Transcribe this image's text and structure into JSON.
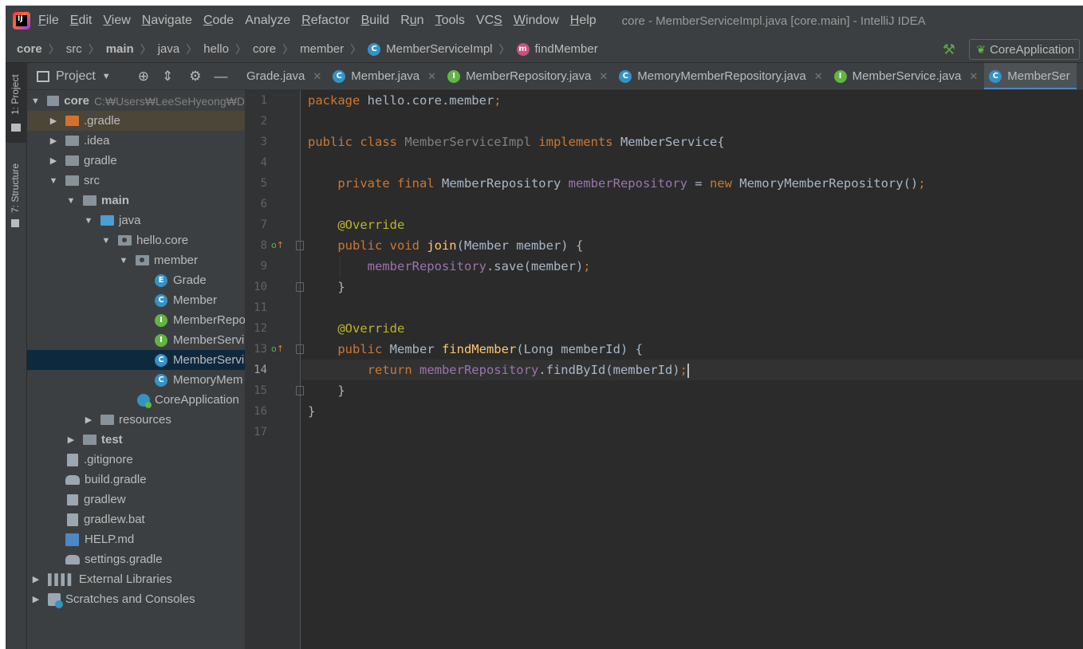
{
  "menubar": {
    "items": [
      {
        "underline": "F",
        "rest": "ile"
      },
      {
        "underline": "E",
        "rest": "dit"
      },
      {
        "underline": "V",
        "rest": "iew"
      },
      {
        "underline": "N",
        "rest": "avigate"
      },
      {
        "underline": "C",
        "rest": "ode"
      },
      {
        "underline": "",
        "rest": "Analyze"
      },
      {
        "underline": "R",
        "rest": "efactor"
      },
      {
        "underline": "B",
        "rest": "uild"
      },
      {
        "pre": "R",
        "underline": "u",
        "rest": "n"
      },
      {
        "underline": "T",
        "rest": "ools"
      },
      {
        "pre": "VC",
        "underline": "S",
        "rest": ""
      },
      {
        "underline": "W",
        "rest": "indow"
      },
      {
        "underline": "H",
        "rest": "elp"
      }
    ],
    "window_title": "core - MemberServiceImpl.java [core.main] - IntelliJ IDEA"
  },
  "navbar": {
    "crumbs": [
      "core",
      "src",
      "main",
      "java",
      "hello",
      "core",
      "member",
      "MemberServiceImpl",
      "findMember"
    ],
    "run_config": "CoreApplication"
  },
  "tool_strip": {
    "project_tab": "1: Project",
    "structure_tab": "7: Structure"
  },
  "project_panel": {
    "title": "Project",
    "tree": [
      {
        "label": "core",
        "hint": "C:₩Users₩LeeSeHyeong₩D"
      },
      {
        "label": ".gradle"
      },
      {
        "label": ".idea"
      },
      {
        "label": "gradle"
      },
      {
        "label": "src"
      },
      {
        "label": "main"
      },
      {
        "label": "java"
      },
      {
        "label": "hello.core"
      },
      {
        "label": "member"
      },
      {
        "label": "Grade"
      },
      {
        "label": "Member"
      },
      {
        "label": "MemberRepo"
      },
      {
        "label": "MemberServi"
      },
      {
        "label": "MemberServi"
      },
      {
        "label": "MemoryMem"
      },
      {
        "label": "CoreApplication"
      },
      {
        "label": "resources"
      },
      {
        "label": "test"
      },
      {
        "label": ".gitignore"
      },
      {
        "label": "build.gradle"
      },
      {
        "label": "gradlew"
      },
      {
        "label": "gradlew.bat"
      },
      {
        "label": "HELP.md"
      },
      {
        "label": "settings.gradle"
      },
      {
        "label": "External Libraries"
      },
      {
        "label": "Scratches and Consoles"
      }
    ]
  },
  "editor": {
    "tabs": [
      {
        "label": "Grade.java"
      },
      {
        "label": "Member.java",
        "icon": "C"
      },
      {
        "label": "MemberRepository.java",
        "icon": "I"
      },
      {
        "label": "MemoryMemberRepository.java",
        "icon": "C"
      },
      {
        "label": "MemberService.java",
        "icon": "I"
      },
      {
        "label": "MemberSer",
        "icon": "C"
      }
    ],
    "line_numbers": [
      "1",
      "2",
      "3",
      "4",
      "5",
      "6",
      "7",
      "8",
      "9",
      "10",
      "11",
      "12",
      "13",
      "14",
      "15",
      "16",
      "17"
    ],
    "current_line": "14",
    "code": {
      "l1_kw": "package ",
      "l1_rest": "hello.core.member",
      "l1_semi": ";",
      "l3_kw": "public class ",
      "l3_cls": "MemberServiceImpl ",
      "l3_kw2": "implements ",
      "l3_rest": "MemberService{",
      "l5_kw": "private final ",
      "l5_type": "MemberRepository ",
      "l5_field": "memberRepository",
      "l5_eq": " = ",
      "l5_new": "new ",
      "l5_rest": "MemoryMemberRepository()",
      "l5_semi": ";",
      "l7_ann": "@Override",
      "l8_kw": "public void ",
      "l8_fn": "join",
      "l8_rest": "(Member member) {",
      "l9_field": "memberRepository",
      "l9_rest": ".save(member)",
      "l9_semi": ";",
      "l10": "}",
      "l12_ann": "@Override",
      "l13_kw": "public ",
      "l13_type": "Member ",
      "l13_fn": "findMember",
      "l13_rest": "(Long memberId) {",
      "l14_kw": "return ",
      "l14_field": "memberRepository",
      "l14_rest": ".findById(memberId)",
      "l14_semi": ";",
      "l15": "}",
      "l16": "}"
    },
    "gutter_marks": [
      "o↑",
      "o↑"
    ]
  }
}
